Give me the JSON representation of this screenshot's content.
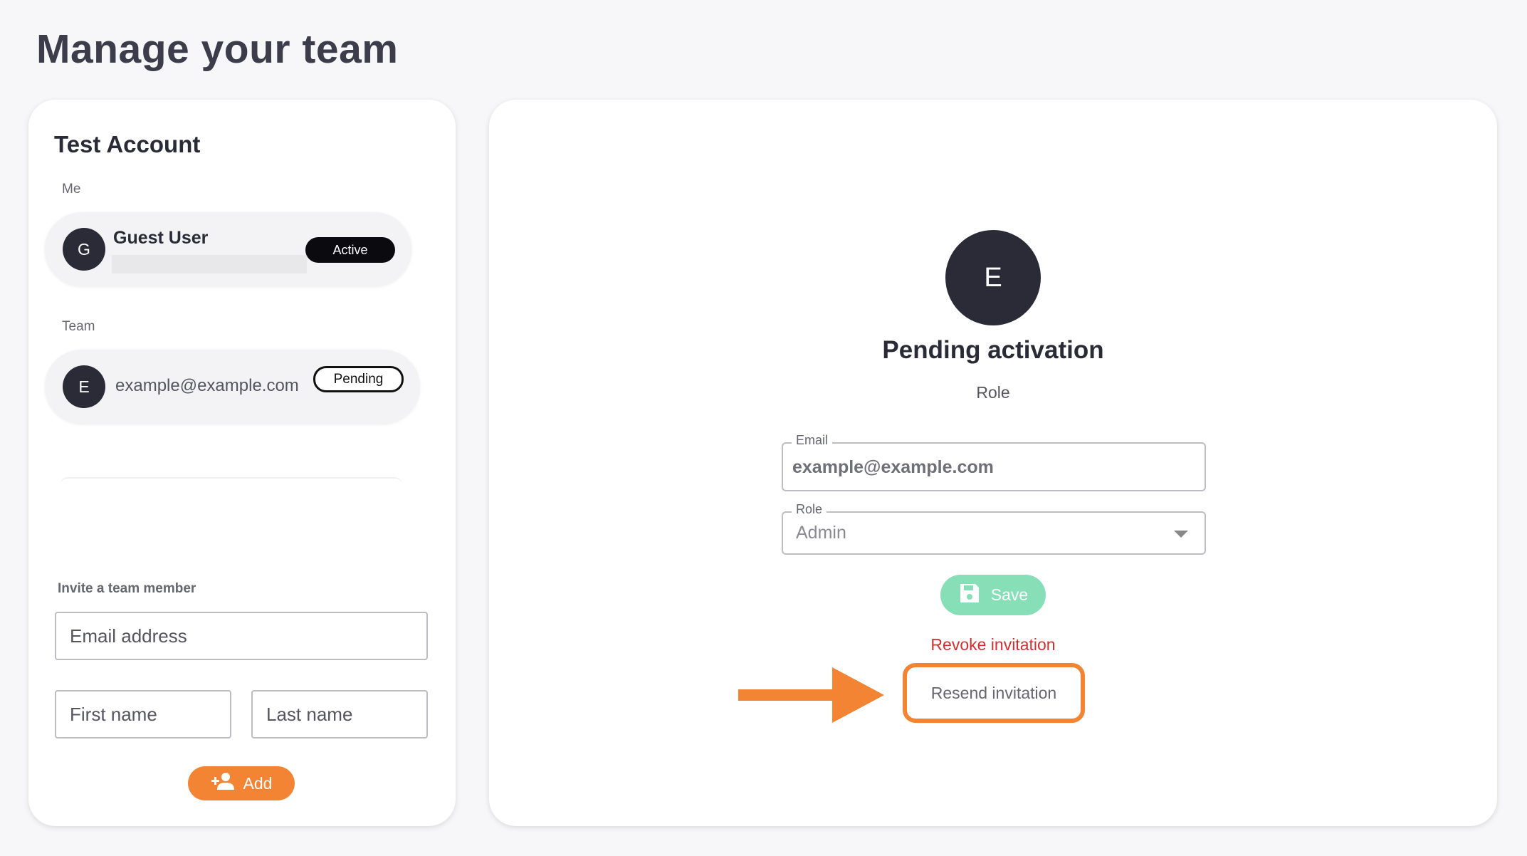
{
  "page": {
    "title": "Manage your team"
  },
  "account": {
    "name": "Test Account",
    "me_label": "Me",
    "me": {
      "initial": "G",
      "name": "Guest User",
      "status": "Active"
    },
    "team_label": "Team",
    "team": [
      {
        "initial": "E",
        "email": "example@example.com",
        "status": "Pending"
      }
    ]
  },
  "invite": {
    "label": "Invite a team member",
    "email_placeholder": "Email address",
    "first_name_placeholder": "First name",
    "last_name_placeholder": "Last name",
    "add_label": "Add"
  },
  "detail": {
    "initial": "E",
    "status_title": "Pending activation",
    "role_caption": "Role",
    "email_legend": "Email",
    "email_value": "example@example.com",
    "role_legend": "Role",
    "role_value": "Admin",
    "save_label": "Save",
    "revoke_label": "Revoke invitation",
    "resend_label": "Resend invitation"
  },
  "colors": {
    "accent": "#f38433",
    "save": "#86dfb7",
    "danger": "#d32f2f",
    "dark": "#2b2b38"
  },
  "icons": {
    "add": "person-add-icon",
    "save": "floppy-disk-icon",
    "dropdown": "chevron-down-icon",
    "callout": "arrow-right-icon"
  }
}
